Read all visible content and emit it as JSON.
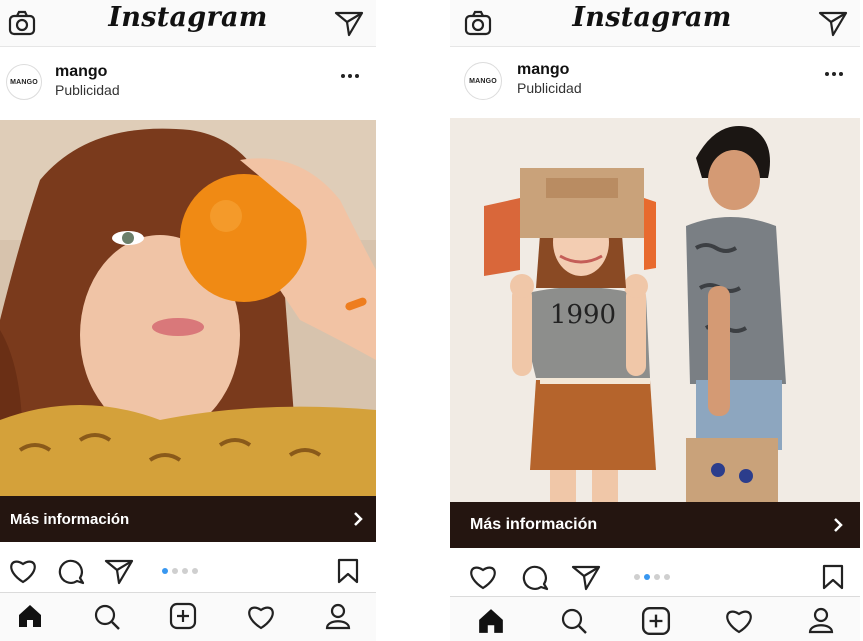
{
  "app_title": "Instagram",
  "colors": {
    "cta_background": "#241510",
    "active_dot": "#3897f0",
    "orange": "#f08a14"
  },
  "posts": [
    {
      "account": {
        "avatar_text": "MANGO",
        "username": "mango",
        "sponsored_label": "Publicidad"
      },
      "cta_label": "Más información",
      "carousel": {
        "total": 4,
        "active_index": 1
      }
    },
    {
      "account": {
        "avatar_text": "MANGO",
        "username": "mango",
        "sponsored_label": "Publicidad"
      },
      "cta_label": "Más información",
      "carousel": {
        "total": 4,
        "active_index": 2
      },
      "shirt_print": "1990"
    }
  ],
  "icons": {
    "top": [
      "camera-icon",
      "direct-message-icon"
    ],
    "post": [
      "more-options-icon",
      "heart-icon",
      "comment-icon",
      "share-icon",
      "bookmark-icon",
      "chevron-right-icon"
    ],
    "tabs": [
      "home-icon",
      "search-icon",
      "new-post-icon",
      "activity-heart-icon",
      "profile-icon"
    ]
  }
}
